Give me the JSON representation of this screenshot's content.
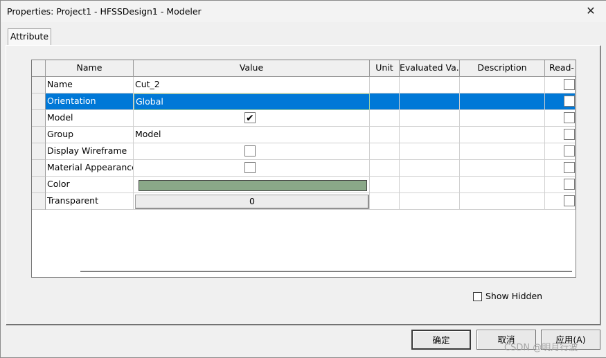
{
  "window": {
    "title": "Properties: Project1 - HFSSDesign1 - Modeler",
    "close_glyph": "✕"
  },
  "tabs": [
    {
      "label": "Attribute"
    }
  ],
  "grid": {
    "columns": [
      "Name",
      "Value",
      "Unit",
      "Evaluated Va...",
      "Description",
      "Read-"
    ],
    "rows": [
      {
        "name": "Name",
        "value": "Cut_2"
      },
      {
        "name": "Orientation",
        "value": "Global",
        "selected": true
      },
      {
        "name": "Model",
        "value_type": "checkbox",
        "checked": true
      },
      {
        "name": "Group",
        "value": "Model"
      },
      {
        "name": "Display Wireframe",
        "value_type": "checkbox",
        "checked": false
      },
      {
        "name": "Material Appearance",
        "value_type": "checkbox",
        "checked": false
      },
      {
        "name": "Color",
        "value_type": "color",
        "color": "#8aa888"
      },
      {
        "name": "Transparent",
        "value": "0",
        "value_type": "button"
      }
    ]
  },
  "show_hidden": {
    "label": "Show Hidden",
    "checked": false
  },
  "buttons": {
    "ok": "确定",
    "cancel": "取消",
    "apply": "应用(A)"
  },
  "watermark": "CSDN @明月行波",
  "colors": {
    "selection": "#0078d7"
  }
}
